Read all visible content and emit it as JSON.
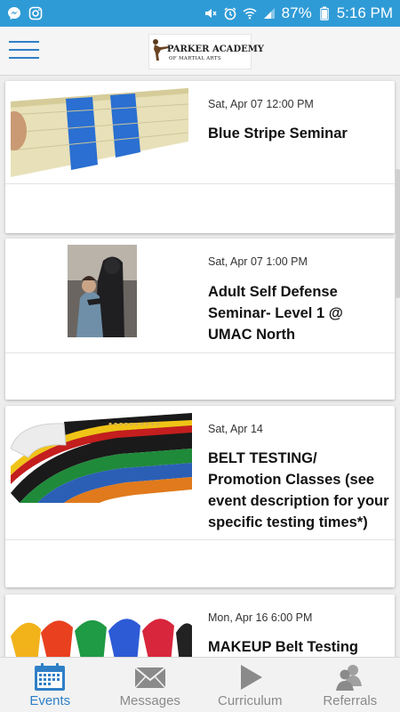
{
  "status_bar": {
    "battery": "87%",
    "time": "5:16 PM",
    "left_icons": [
      "messenger-icon",
      "instagram-icon"
    ],
    "right_icons": [
      "mute-icon",
      "alarm-icon",
      "wifi-icon",
      "signal-icon",
      "battery-icon"
    ]
  },
  "header": {
    "logo_title": "PARKER ACADEMY",
    "logo_subtitle": "OF MARTIAL ARTS"
  },
  "events": [
    {
      "date": "Sat, Apr 07 12:00 PM",
      "title": "Blue Stripe Seminar",
      "image": "blue-stripe-belt-image"
    },
    {
      "date": "Sat, Apr 07 1:00 PM",
      "title": "Adult Self Defense Seminar- Level 1 @ UMAC North",
      "image": "self-defense-photo"
    },
    {
      "date": "Sat, Apr 14",
      "title": "BELT TESTING/ Promotion Classes (see event description for your specific testing times*)",
      "image": "colored-belts-image"
    },
    {
      "date": "Mon, Apr 16 6:00 PM",
      "title": "MAKEUP Belt Testing",
      "image": "belt-knots-image"
    }
  ],
  "bottom_nav": {
    "active": "events",
    "items": [
      {
        "key": "events",
        "label": "Events",
        "icon": "calendar-icon"
      },
      {
        "key": "messages",
        "label": "Messages",
        "icon": "envelope-icon"
      },
      {
        "key": "curriculum",
        "label": "Curriculum",
        "icon": "play-icon"
      },
      {
        "key": "referrals",
        "label": "Referrals",
        "icon": "people-icon"
      }
    ]
  },
  "colors": {
    "status_bar": "#2f9bd6",
    "accent": "#2f7fc7",
    "inactive": "#8a8a8a"
  }
}
